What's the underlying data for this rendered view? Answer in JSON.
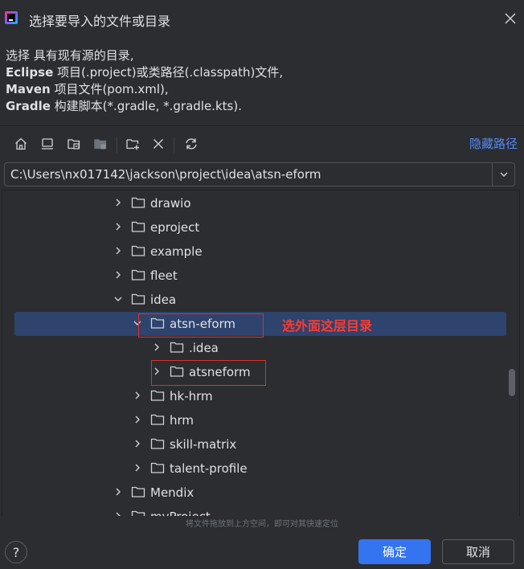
{
  "dialog": {
    "title": "选择要导入的文件或目录"
  },
  "description": {
    "line1_text": "选择 具有现有源的目录,",
    "line2_bold": "Eclipse",
    "line2_rest": " 项目(.project)或类路径(.classpath)文件,",
    "line3_bold": "Maven",
    "line3_rest": " 项目文件(pom.xml),",
    "line4_bold": "Gradle",
    "line4_rest": " 构建脚本(*.gradle, *.gradle.kts)."
  },
  "toolbar": {
    "icons": [
      "home-icon",
      "desktop-icon",
      "project-folder-icon",
      "module-folder-icon",
      "new-folder-icon",
      "delete-icon",
      "refresh-icon"
    ],
    "hide_path_label": "隐藏路径"
  },
  "path": {
    "value": "C:\\Users\\nx017142\\jackson\\project\\idea\\atsn-eform"
  },
  "tree": {
    "rows": [
      {
        "label": "drawio",
        "expanded": false
      },
      {
        "label": "eproject",
        "expanded": false
      },
      {
        "label": "example",
        "expanded": false
      },
      {
        "label": "fleet",
        "expanded": false
      },
      {
        "label": "idea",
        "expanded": true
      },
      {
        "label": "atsn-eform",
        "expanded": true,
        "selected": true
      },
      {
        "label": ".idea",
        "expanded": false
      },
      {
        "label": "atsneform",
        "expanded": false
      },
      {
        "label": "hk-hrm",
        "expanded": false
      },
      {
        "label": "hrm",
        "expanded": false
      },
      {
        "label": "skill-matrix",
        "expanded": false
      },
      {
        "label": "talent-profile",
        "expanded": false
      },
      {
        "label": "Mendix",
        "expanded": false
      },
      {
        "label": "myProject",
        "expanded": false
      }
    ]
  },
  "annotation": {
    "text": "选外面这层目录",
    "color": "#ff3b30"
  },
  "hint": {
    "text": "将文件拖放到上方空间，即可对其快速定位"
  },
  "buttons": {
    "help": "?",
    "ok": "确定",
    "cancel": "取消"
  },
  "colors": {
    "background": "#2b2d30",
    "selection": "#2e436e",
    "accent": "#3574f0",
    "link": "#548af7"
  }
}
